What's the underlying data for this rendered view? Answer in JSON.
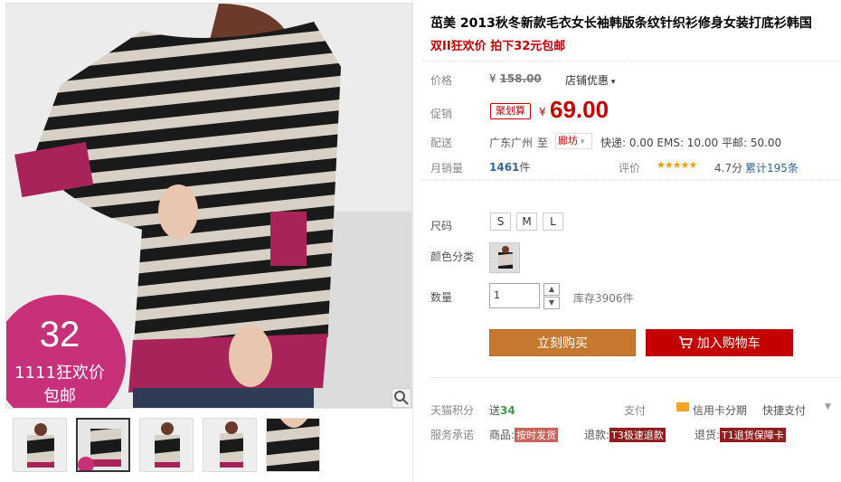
{
  "product": {
    "title": "茁美 2013秋冬新款毛衣女长袖韩版条纹针织衫修身女装打底衫韩国",
    "promo": "双II狂欢价 拍下32元包邮"
  },
  "badge": {
    "num": "32",
    "line2": "1111狂欢价",
    "line3": "包邮"
  },
  "price": {
    "price_label": "价格",
    "yen": "¥",
    "original": "158.00",
    "shop_discount": "店铺优惠",
    "promo_label": "促销",
    "promo_tag": "聚划算",
    "current": "69.00",
    "ship_label": "配送",
    "ship_from": "广东广州",
    "ship_to_word": "至",
    "ship_to_select": "廊坊",
    "ship_fees": "快递: 0.00 EMS: 10.00 平邮: 50.00",
    "monthly_label": "月销量",
    "monthly_value": "1461",
    "monthly_unit": "件",
    "rating_label": "评价",
    "stars": "★★★★★",
    "rating_value": "4.7分",
    "total_reviews": "累计195条"
  },
  "options": {
    "size_label": "尺码",
    "sizes": [
      "S",
      "M",
      "L"
    ],
    "color_label": "颜色分类",
    "qty_label": "数量",
    "qty_value": "1",
    "stock": "库存3906件"
  },
  "actions": {
    "buy": "立刻购买",
    "cart": "加入购物车",
    "cart_icon": "cart-icon"
  },
  "footer": {
    "points_label": "天猫积分",
    "points_prefix": "送",
    "points_value": "34",
    "pay_label": "支付",
    "credit": "信用卡分期",
    "quick_pay": "快捷支付",
    "service_label": "服务承诺",
    "goods_label": "商品:",
    "goods_tag": "按时发货",
    "refund_label": "退款:",
    "refund_tag": "T3极速退款",
    "return_label": "退货:",
    "return_tag": "T1退货保障卡"
  },
  "colors": {
    "accent": "#c40000",
    "buy": "#c7782f",
    "badge": "#c8317a"
  }
}
